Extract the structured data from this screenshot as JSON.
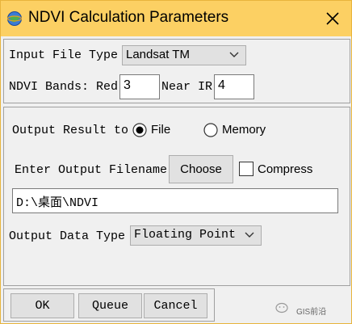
{
  "window": {
    "title": "NDVI Calculation Parameters"
  },
  "input": {
    "file_type_label": "Input File Type",
    "file_type_value": "Landsat TM",
    "bands_label": "NDVI Bands: Red",
    "red_value": "3",
    "near_ir_label": "Near IR",
    "near_ir_value": "4"
  },
  "output": {
    "result_to_label": "Output Result to",
    "file_option": "File",
    "memory_option": "Memory",
    "selected": "File",
    "filename_label": "Enter Output Filename",
    "choose_button": "Choose",
    "compress_label": "Compress",
    "compress_checked": false,
    "path_value": "D:\\桌面\\NDVI",
    "data_type_label": "Output Data Type",
    "data_type_value": "Floating Point"
  },
  "buttons": {
    "ok": "OK",
    "queue": "Queue",
    "cancel": "Cancel"
  },
  "watermark": {
    "text": "GIS前沿"
  },
  "icons": {
    "app": "globe-icon",
    "close": "close-icon",
    "dropdown": "chevron-down-icon"
  }
}
